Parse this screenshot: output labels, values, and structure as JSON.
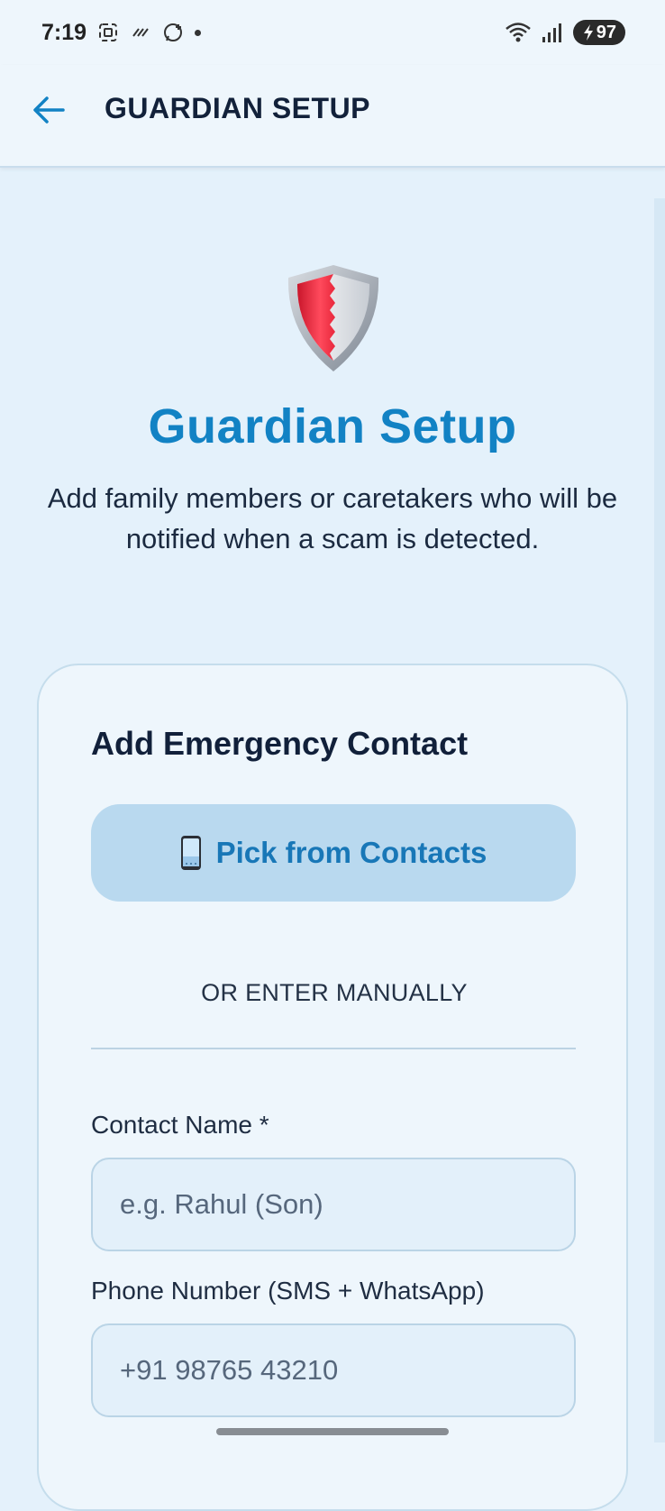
{
  "status_bar": {
    "time": "7:19",
    "battery": "97"
  },
  "app_bar": {
    "title": "GUARDIAN SETUP"
  },
  "hero": {
    "title": "Guardian Setup",
    "subtitle_line1": "Add family members or caretakers who will be",
    "subtitle_line2": "notified when a scam is detected."
  },
  "card": {
    "title": "Add Emergency Contact",
    "pick_button_label": "Pick from Contacts",
    "or_label": "OR ENTER MANUALLY",
    "name_label": "Contact Name *",
    "name_placeholder": "e.g. Rahul (Son)",
    "phone_label": "Phone Number (SMS + WhatsApp)",
    "phone_placeholder": "+91 98765 43210"
  },
  "colors": {
    "accent": "#1282c4",
    "background": "#e4f1fb",
    "pick_button_bg": "#b9d9ef",
    "shield_red": "#e8283c"
  }
}
